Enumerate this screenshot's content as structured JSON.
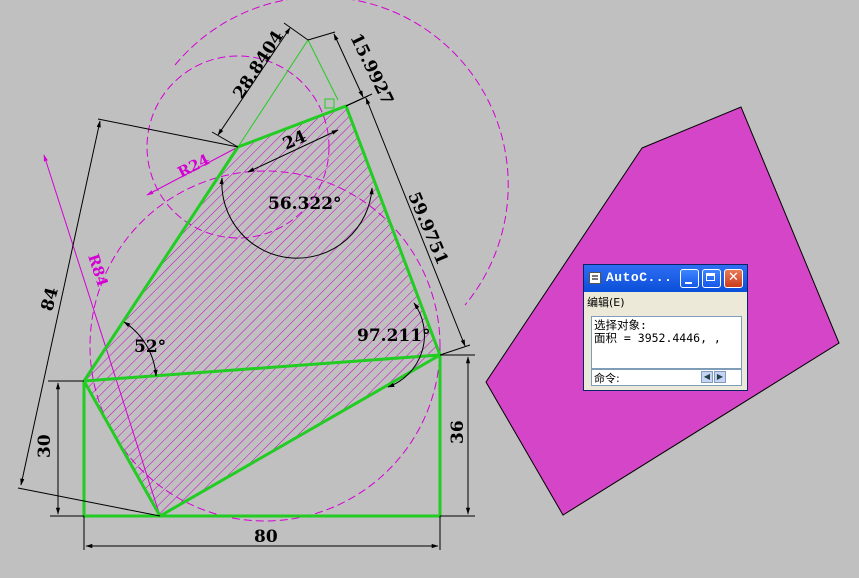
{
  "drawing": {
    "dimensions": {
      "d_28": "28.8404",
      "d_15": "15.9927",
      "d_24": "24",
      "d_59": "59.9751",
      "a_56": "56.322°",
      "a_52": "52°",
      "a_97": "97.211°",
      "d_84": "84",
      "d_30": "30",
      "d_36": "36",
      "d_80": "80",
      "r_24": "R24",
      "r_84": "R84"
    },
    "colors": {
      "background": "#c0c0c0",
      "outline": "#22cc22",
      "construction": "#d400d4",
      "hatch": "#c800c8",
      "filled_region": "#d545c8",
      "dimension": "#000000"
    }
  },
  "autocad_window": {
    "title": "AutoC...",
    "menu": "编辑(E)",
    "lines": [
      "选择对象:",
      "面积 = 3952.4446, ,"
    ],
    "command_prompt": "命令:",
    "icons": [
      "app-icon",
      "minimize-icon",
      "maximize-icon",
      "close-icon",
      "scroll-left-icon",
      "scroll-right-icon"
    ]
  }
}
